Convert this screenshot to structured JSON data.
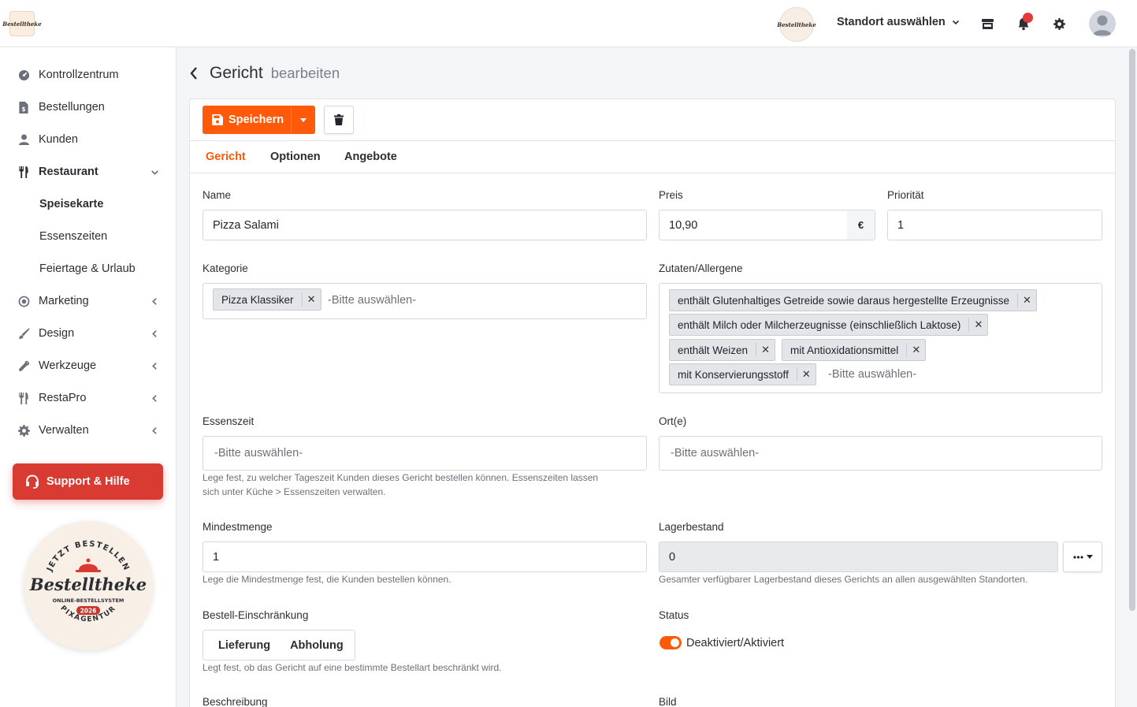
{
  "topbar": {
    "brand_logo_text": "Bestelltheke",
    "location_logo_text": "Bestelltheke",
    "location_select": "Standort auswählen",
    "icons": [
      "store-icon",
      "bell-icon",
      "gear-icon",
      "user-avatar-icon"
    ]
  },
  "sidebar": {
    "items": [
      {
        "label": "Kontrollzentrum",
        "icon": "dashboard-icon"
      },
      {
        "label": "Bestellungen",
        "icon": "receipt-icon"
      },
      {
        "label": "Kunden",
        "icon": "user-icon"
      },
      {
        "label": "Restaurant",
        "icon": "utensils-icon",
        "expanded": true
      },
      {
        "label": "Marketing",
        "icon": "target-icon"
      },
      {
        "label": "Design",
        "icon": "brush-icon"
      },
      {
        "label": "Werkzeuge",
        "icon": "wrench-icon"
      },
      {
        "label": "RestaPro",
        "icon": "utensils-icon"
      },
      {
        "label": "Verwalten",
        "icon": "cog-icon"
      }
    ],
    "restaurant_sub": [
      "Speisekarte",
      "Essenszeiten",
      "Feiertage & Urlaub"
    ],
    "support_label": "Support & Hilfe",
    "seal": {
      "top_text": "JETZT BESTELLEN",
      "brand": "Bestelltheke",
      "line": "ONLINE-BESTELLSYSTEM",
      "year": "2026",
      "bottom_text": "PIXAGENTUR"
    }
  },
  "header": {
    "title": "Gericht",
    "subtitle": "bearbeiten"
  },
  "toolbar": {
    "save_label": "Speichern"
  },
  "tabs": [
    "Gericht",
    "Optionen",
    "Angebote"
  ],
  "form": {
    "name": {
      "label": "Name",
      "value": "Pizza Salami"
    },
    "preis": {
      "label": "Preis",
      "value": "10,90",
      "currency": "€"
    },
    "prioritaet": {
      "label": "Priorität",
      "value": "1"
    },
    "kategorie": {
      "label": "Kategorie",
      "chips": [
        "Pizza Klassiker"
      ],
      "placeholder": "-Bitte auswählen-"
    },
    "zutaten": {
      "label": "Zutaten/Allergene",
      "chips": [
        "enthält Glutenhaltiges Getreide sowie daraus hergestellte Erzeugnisse",
        "enthält Milch oder Milcherzeugnisse (einschließlich Laktose)",
        "enthält Weizen",
        "mit Antioxidationsmittel",
        "mit Konservierungsstoff"
      ],
      "placeholder": "-Bitte auswählen-"
    },
    "essenszeit": {
      "label": "Essenszeit",
      "placeholder": "-Bitte auswählen-",
      "help_1": "Lege fest, zu welcher Tageszeit Kunden dieses Gericht bestellen können. Essenszeiten lassen",
      "help_2": "sich unter Küche > Essenszeiten verwalten."
    },
    "orte": {
      "label": "Ort(e)",
      "placeholder": "-Bitte auswählen-"
    },
    "mindestmenge": {
      "label": "Mindestmenge",
      "value": "1",
      "help": "Lege die Mindestmenge fest, die Kunden bestellen können."
    },
    "lagerbestand": {
      "label": "Lagerbestand",
      "value": "0",
      "help": "Gesamter verfügbarer Lagerbestand dieses Gerichts an allen ausgewählten Standorten."
    },
    "bestell": {
      "label": "Bestell-Einschränkung",
      "options": [
        "Lieferung",
        "Abholung"
      ],
      "help": "Legt fest, ob das Gericht auf eine bestimmte Bestellart beschränkt wird."
    },
    "status": {
      "label": "Status",
      "toggle_label": "Deaktiviert/Aktiviert",
      "enabled": true
    },
    "beschreibung": {
      "label": "Beschreibung"
    },
    "bild": {
      "label": "Bild"
    }
  },
  "colors": {
    "accent": "#ff5a0a",
    "support": "#d93a31"
  }
}
